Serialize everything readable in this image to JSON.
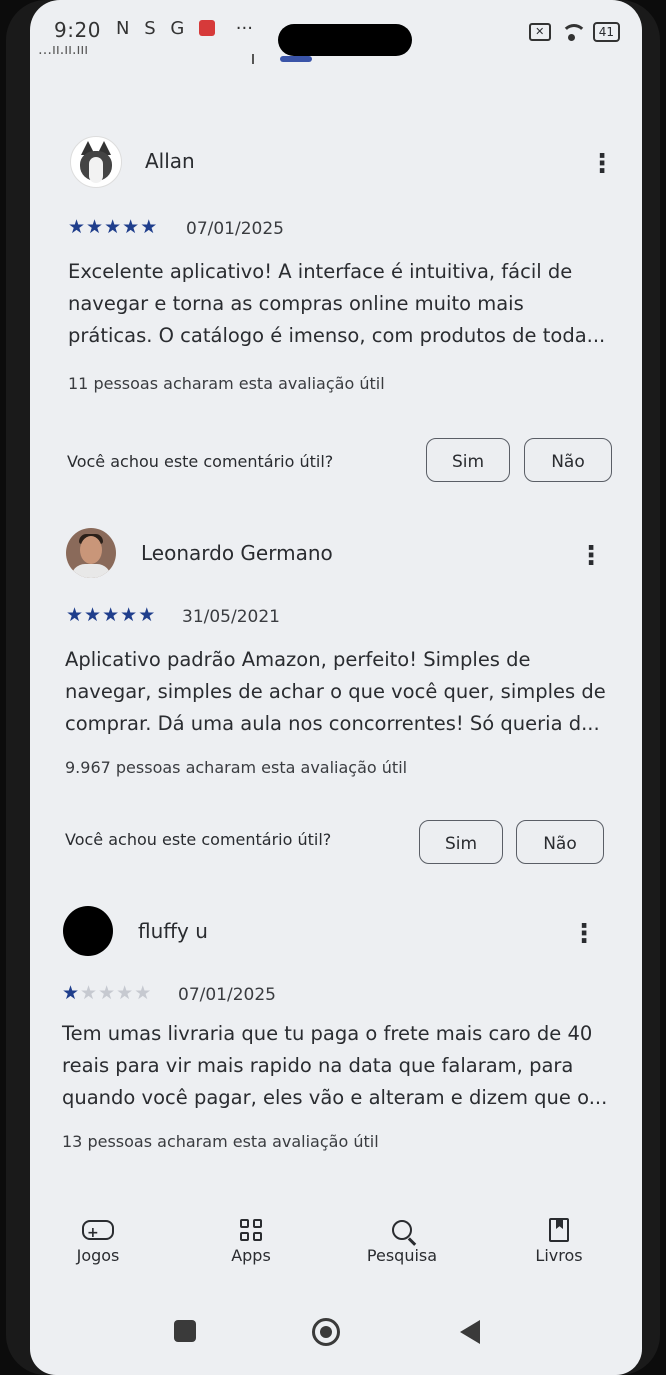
{
  "status_bar": {
    "time": "9:20",
    "left_icons": [
      "N",
      "S",
      "G"
    ],
    "dots": "···",
    "battery": "41"
  },
  "peek_text": "…ıı.ıı.ııı",
  "reviews": [
    {
      "name": "Allan",
      "avatar": "husky-avatar",
      "stars": 5,
      "date": "07/01/2025",
      "lines": [
        "Excelente aplicativo! A interface é intuitiva, fácil de",
        "navegar e torna as compras online muito mais",
        "práticas. O catálogo é imenso, com produtos de toda..."
      ],
      "helpful_count": "11 pessoas acharam esta avaliação útil",
      "question": "Você achou este comentário útil?",
      "yes": "Sim",
      "no": "Não"
    },
    {
      "name": "Leonardo Germano",
      "avatar": "person-photo-avatar",
      "stars": 5,
      "date": "31/05/2021",
      "lines": [
        "Aplicativo padrão Amazon, perfeito! Simples de",
        "navegar, simples de achar o que você quer, simples de",
        "comprar. Dá uma aula nos concorrentes! Só queria d..."
      ],
      "helpful_count": "9.967 pessoas acharam esta avaliação útil",
      "question": "Você achou este comentário útil?",
      "yes": "Sim",
      "no": "Não"
    },
    {
      "name": "fluffy u",
      "avatar": "black-avatar",
      "stars": 1,
      "date": "07/01/2025",
      "lines": [
        "Tem umas livraria que tu paga o frete mais caro de 40",
        "reais para vir mais rapido na data que falaram, para",
        "quando você pagar, eles vão e alteram e dizem que o..."
      ],
      "helpful_count": "13 pessoas acharam esta avaliação útil"
    }
  ],
  "bottom_nav": {
    "items": [
      {
        "label": "Jogos",
        "icon": "gamepad-icon"
      },
      {
        "label": "Apps",
        "icon": "apps-grid-icon"
      },
      {
        "label": "Pesquisa",
        "icon": "search-icon"
      },
      {
        "label": "Livros",
        "icon": "book-icon"
      }
    ]
  },
  "system_nav": [
    "recent-apps",
    "home",
    "back"
  ],
  "colors": {
    "background": "#edeff2",
    "star_filled": "#1f3e8c",
    "star_empty": "#c6c9d0",
    "text": "#2a2c30"
  }
}
